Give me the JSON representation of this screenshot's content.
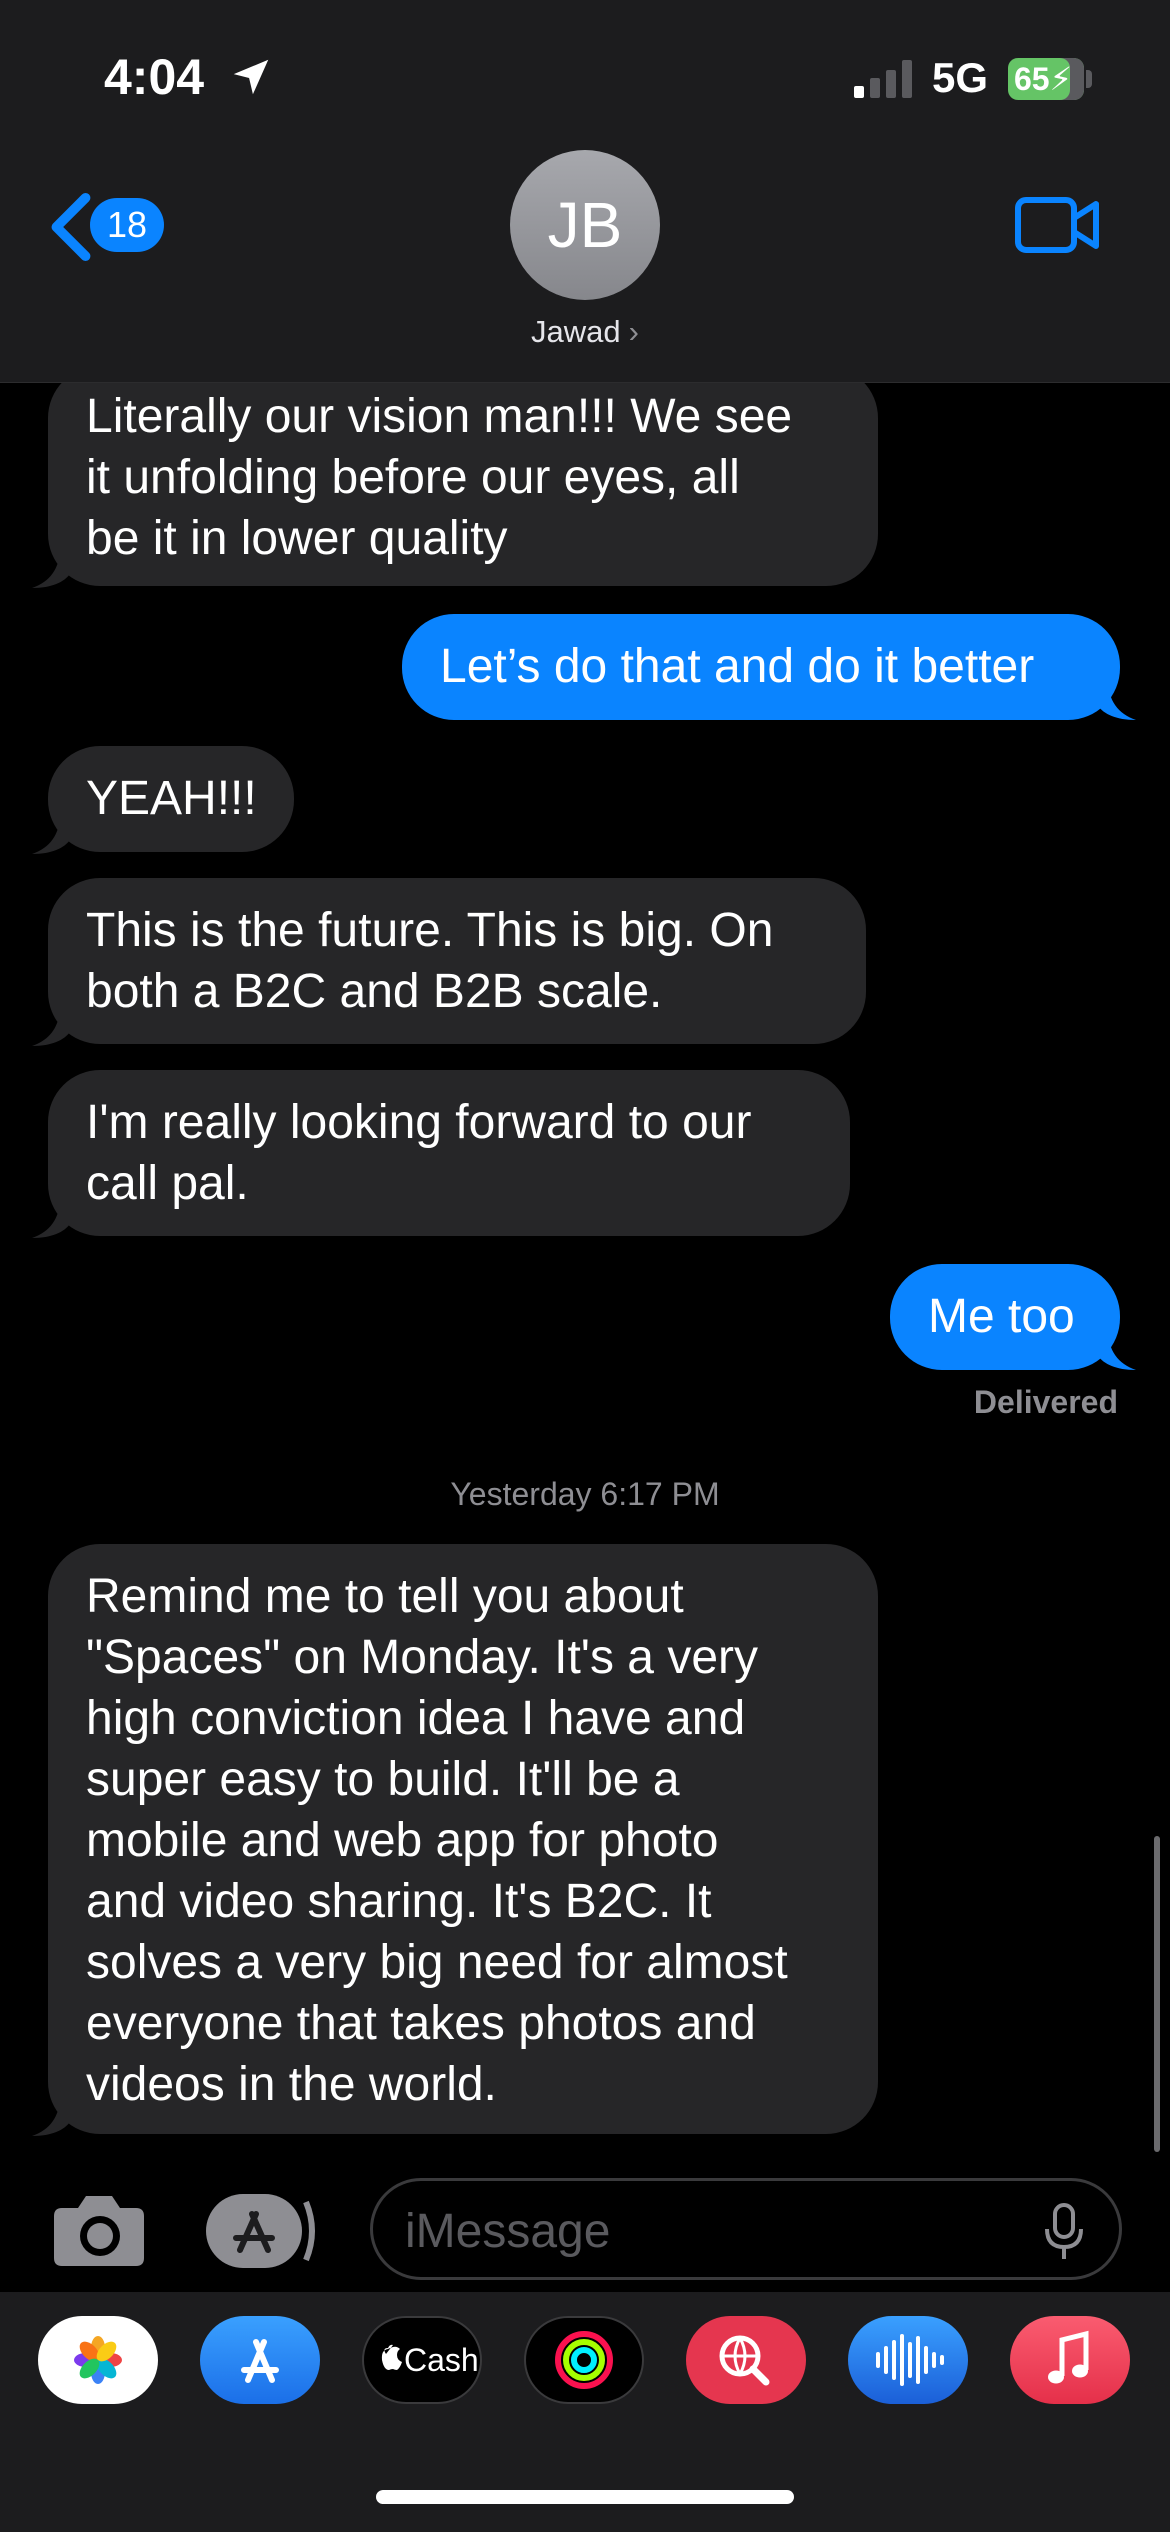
{
  "status_bar": {
    "time": "4:04",
    "network": "5G",
    "battery": "65"
  },
  "header": {
    "back_count": "18",
    "avatar_initials": "JB",
    "contact_name": "Jawad",
    "name_chevron": "›"
  },
  "messages": [
    {
      "direction": "incoming",
      "text": "Literally our vision man!!! We see\nit unfolding before our eyes, all\nbe it in lower quality"
    },
    {
      "direction": "outgoing",
      "text": "Let’s do that and do it better"
    },
    {
      "direction": "incoming",
      "text": "YEAH!!!"
    },
    {
      "direction": "incoming",
      "text": "This is the future. This is big. On\nboth a B2C and B2B scale."
    },
    {
      "direction": "incoming",
      "text": "I'm really looking forward to our\ncall pal."
    },
    {
      "direction": "outgoing",
      "text": "Me too"
    },
    {
      "direction": "incoming",
      "text": "Remind me to tell you about\n\"Spaces\" on Monday. It's a very\nhigh conviction idea I have and\nsuper easy to build. It'll be a\nmobile and web app for photo\nand video sharing. It's B2C. It\nsolves a very big need for almost\neveryone that takes photos and\nvideos in the world."
    }
  ],
  "delivered_label": "Delivered",
  "timestamp": "Yesterday 6:17 PM",
  "input": {
    "placeholder": "iMessage",
    "value": ""
  },
  "app_drawer": {
    "apps": [
      "Photos",
      "App Store",
      "Apple Cash",
      "Activity",
      "Web Search",
      "Audio Message",
      "Music"
    ],
    "cash_label": "Cash"
  },
  "colors": {
    "outgoing_bubble": "#0a84ff",
    "incoming_bubble": "#262628",
    "background": "#000000"
  }
}
